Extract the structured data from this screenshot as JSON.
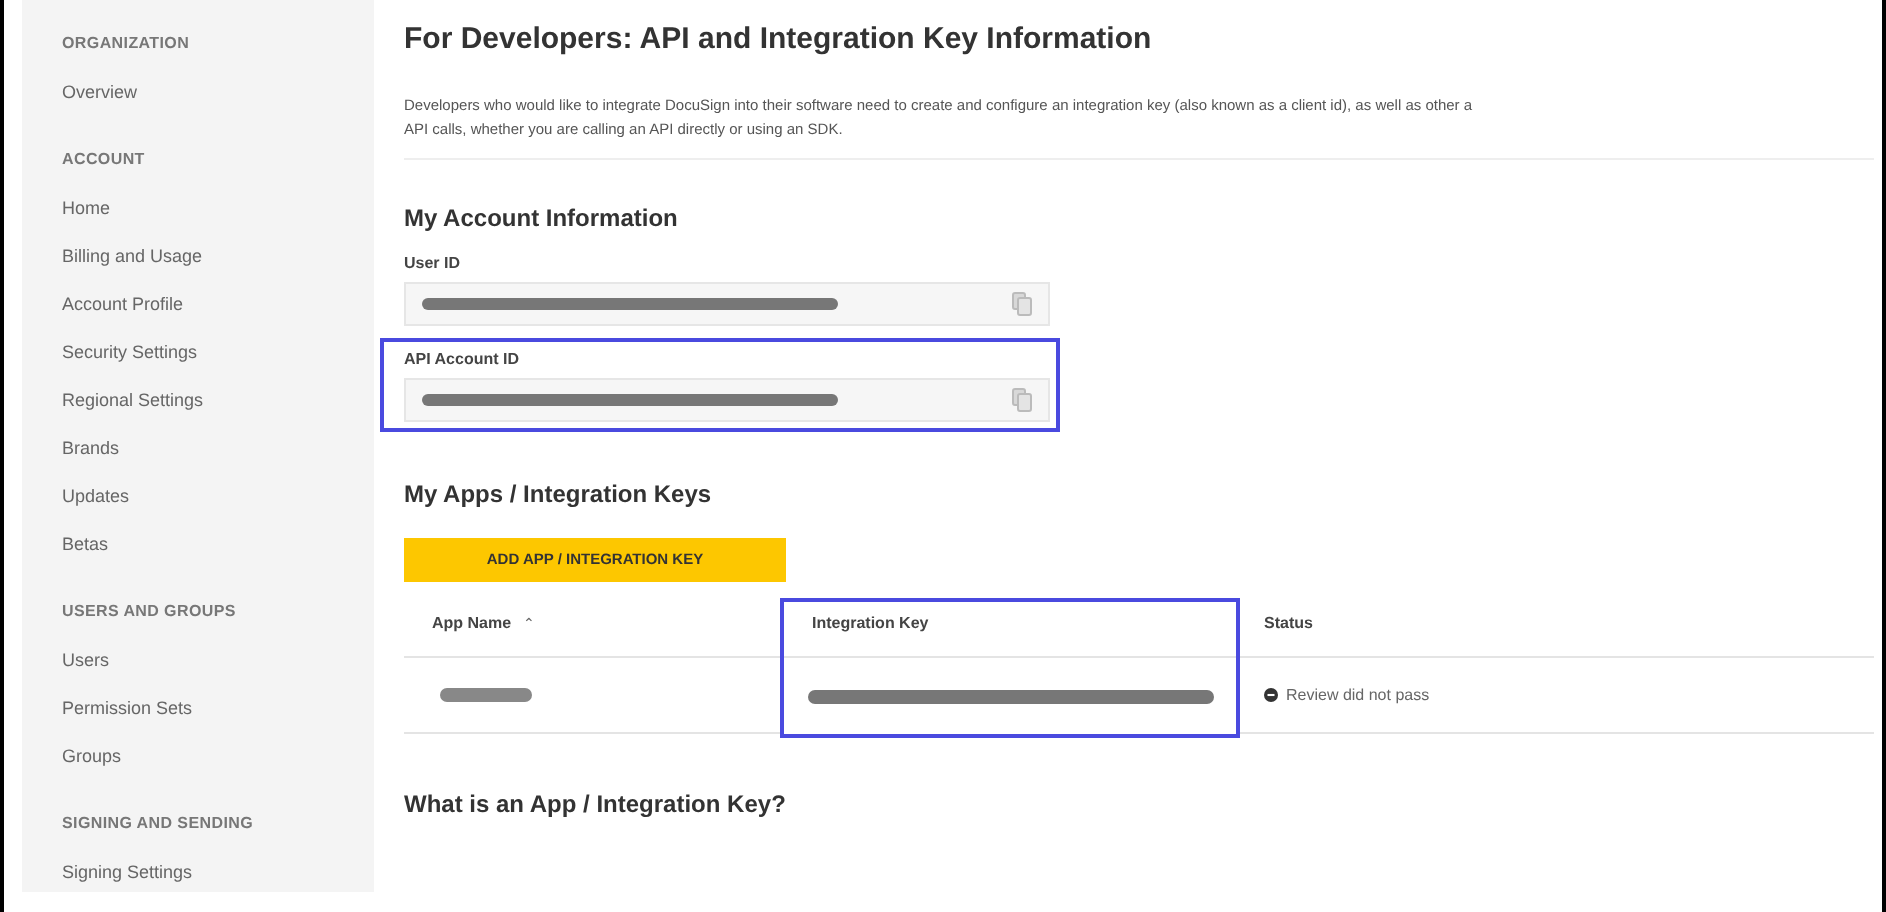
{
  "sidebar": {
    "sections": [
      {
        "heading": "ORGANIZATION",
        "items": [
          {
            "label": "Overview"
          }
        ]
      },
      {
        "heading": "ACCOUNT",
        "items": [
          {
            "label": "Home"
          },
          {
            "label": "Billing and Usage"
          },
          {
            "label": "Account Profile"
          },
          {
            "label": "Security Settings"
          },
          {
            "label": "Regional Settings"
          },
          {
            "label": "Brands"
          },
          {
            "label": "Updates"
          },
          {
            "label": "Betas"
          }
        ]
      },
      {
        "heading": "USERS AND GROUPS",
        "items": [
          {
            "label": "Users"
          },
          {
            "label": "Permission Sets"
          },
          {
            "label": "Groups"
          }
        ]
      },
      {
        "heading": "SIGNING AND SENDING",
        "items": [
          {
            "label": "Signing Settings"
          }
        ]
      }
    ]
  },
  "page": {
    "title": "For Developers: API and Integration Key Information",
    "description": "Developers who would like to integrate DocuSign into their software need to create and configure an integration key (also known as a client id), as well as other a\nAPI calls, whether you are calling an API directly or using an SDK."
  },
  "account_info": {
    "heading": "My Account Information",
    "fields": [
      {
        "label": "User ID",
        "highlighted": false
      },
      {
        "label": "API Account ID",
        "highlighted": true
      }
    ]
  },
  "apps": {
    "heading": "My Apps / Integration Keys",
    "add_button": "ADD APP / INTEGRATION KEY",
    "columns": [
      {
        "label": "App Name",
        "sort_icon": "⌃",
        "highlighted": false
      },
      {
        "label": "Integration Key",
        "highlighted": true
      },
      {
        "label": "Status",
        "highlighted": false
      }
    ],
    "rows": [
      {
        "status": "Review did not pass"
      }
    ]
  },
  "faq_heading": "What is an App / Integration Key?"
}
